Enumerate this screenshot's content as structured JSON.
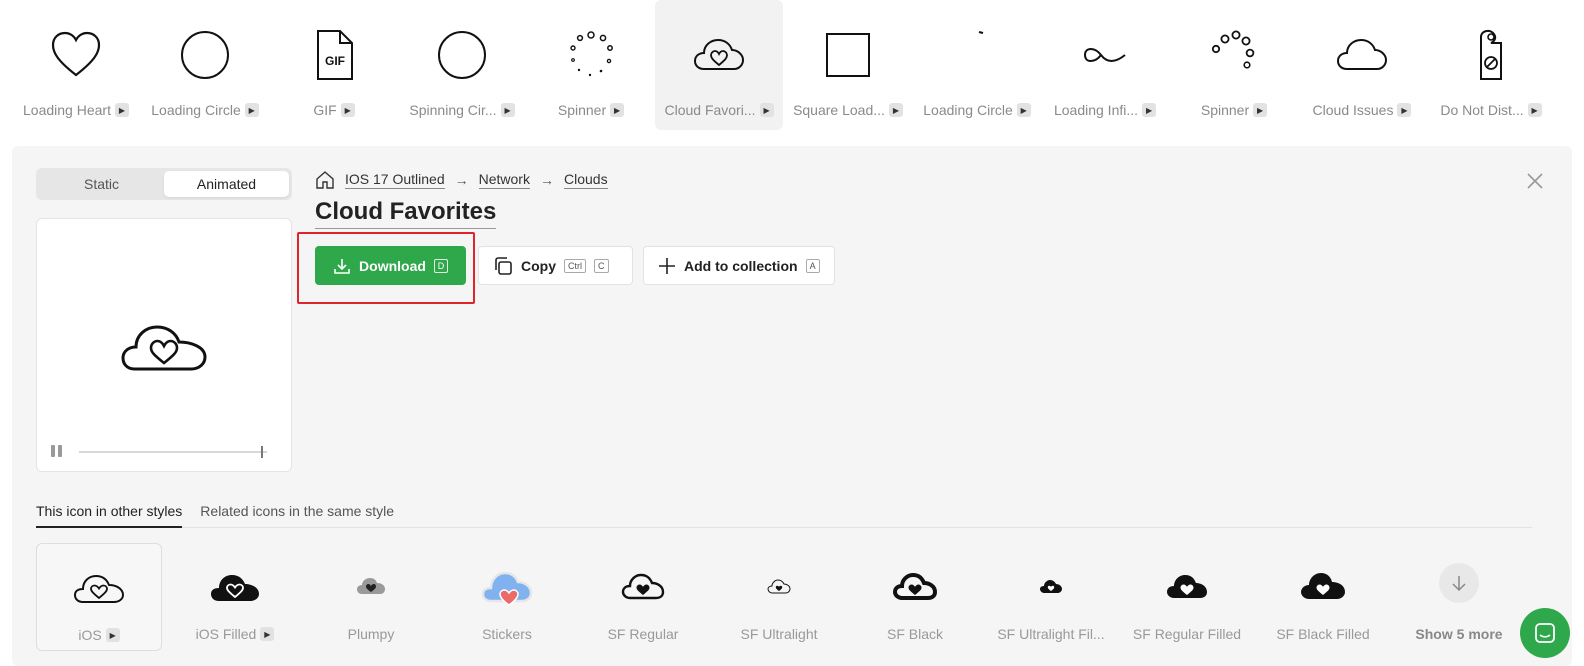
{
  "strip": {
    "items": [
      {
        "label": "Loading Heart",
        "icon": "heart-icon",
        "animated": true
      },
      {
        "label": "Loading Circle",
        "icon": "circle-icon",
        "animated": true
      },
      {
        "label": "GIF",
        "icon": "gif-file-icon",
        "animated": true
      },
      {
        "label": "Spinning Cir...",
        "icon": "spinning-circle-icon",
        "animated": true
      },
      {
        "label": "Spinner",
        "icon": "spinner-dots-icon",
        "animated": true
      },
      {
        "label": "Cloud Favori...",
        "icon": "cloud-heart-icon",
        "animated": true,
        "selected": true
      },
      {
        "label": "Square Load...",
        "icon": "square-icon",
        "animated": true
      },
      {
        "label": "Loading Circle",
        "icon": "loading-arc-icon",
        "animated": true
      },
      {
        "label": "Loading Infi...",
        "icon": "infinity-icon",
        "animated": true
      },
      {
        "label": "Spinner",
        "icon": "spinner-circles-icon",
        "animated": true
      },
      {
        "label": "Cloud Issues",
        "icon": "cloud-icon",
        "animated": true
      },
      {
        "label": "Do Not Dist...",
        "icon": "door-hanger-icon",
        "animated": true
      }
    ]
  },
  "toggle": {
    "static": "Static",
    "animated": "Animated",
    "active": "Animated"
  },
  "breadcrumb": {
    "items": [
      "IOS 17 Outlined",
      "Network",
      "Clouds"
    ],
    "separator": "→"
  },
  "icon": {
    "title": "Cloud Favorites"
  },
  "actions": {
    "download": {
      "label": "Download",
      "key": "D"
    },
    "copy": {
      "label": "Copy",
      "keys": [
        "Ctrl",
        "C"
      ]
    },
    "add": {
      "label": "Add to collection",
      "key": "A"
    }
  },
  "player": {
    "progress": 0.97
  },
  "tabs": [
    {
      "label": "This icon in other styles",
      "active": true
    },
    {
      "label": "Related icons in the same style",
      "active": false
    }
  ],
  "styles": [
    {
      "label": "iOS",
      "icon": "cloud-heart-outline-icon",
      "animated": true,
      "selected": true
    },
    {
      "label": "iOS Filled",
      "icon": "cloud-heart-filled-icon",
      "animated": true
    },
    {
      "label": "Plumpy",
      "icon": "cloud-heart-plumpy-icon",
      "animated": false
    },
    {
      "label": "Stickers",
      "icon": "cloud-heart-sticker-icon",
      "animated": false
    },
    {
      "label": "SF Regular",
      "icon": "cloud-heart-sf-regular-icon",
      "animated": false
    },
    {
      "label": "SF Ultralight",
      "icon": "cloud-heart-sf-ultralight-icon",
      "animated": false
    },
    {
      "label": "SF Black",
      "icon": "cloud-heart-sf-black-icon",
      "animated": false
    },
    {
      "label": "SF Ultralight Fil...",
      "icon": "cloud-heart-sf-ultralight-filled-icon",
      "animated": false
    },
    {
      "label": "SF Regular Filled",
      "icon": "cloud-heart-sf-regular-filled-icon",
      "animated": false
    },
    {
      "label": "SF Black Filled",
      "icon": "cloud-heart-sf-black-filled-icon",
      "animated": false
    },
    {
      "label": "Show 5 more",
      "icon": "arrow-down-icon",
      "animated": false
    }
  ],
  "colors": {
    "accent": "#2ea84a",
    "highlight": "#e0242b",
    "panel": "#f5f5f5"
  }
}
